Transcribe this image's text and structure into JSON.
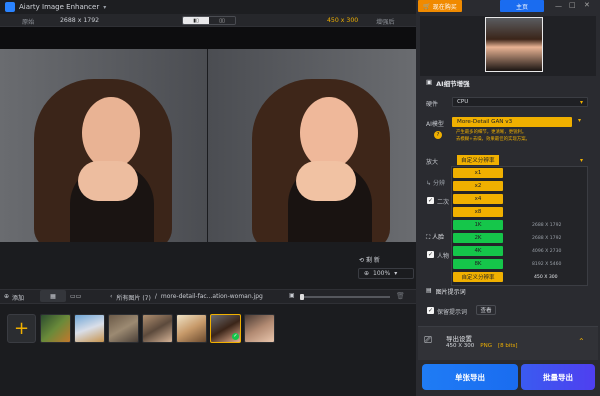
{
  "app": {
    "title": "Aiarty Image Enhancer"
  },
  "compare_bar": {
    "original_label": "原始",
    "original_size": "2688 x 1792",
    "output_size": "450 x 300",
    "output_label": "增强后"
  },
  "preview_controls": {
    "reset_label": "剩 新",
    "zoom": "100%"
  },
  "tabs": {
    "add_label": "添加",
    "breadcrumb_all": "所有图片 (7)",
    "breadcrumb_sep": "/",
    "file_name": "more-detail-fac...ation-woman.jpg"
  },
  "top_buttons": {
    "buy_label": "现在购买",
    "home_label": "主页"
  },
  "side": {
    "section_title": "AI细节增强",
    "hardware_label": "硬件",
    "hardware_value": "CPU",
    "model_label": "AI模型",
    "model_value": "More-Detail GAN  v3",
    "model_desc_line1": "产生最多的细节，更清晰，更锐利。",
    "model_desc_line2": "去模糊+去噪，效果最佳的实现方案。",
    "scale_label": "放大",
    "scale_value": "自定义分辨率",
    "scale_options": [
      {
        "label": "x1",
        "value": "",
        "color": "#f0b000"
      },
      {
        "label": "x2",
        "value": "",
        "color": "#f0b000"
      },
      {
        "label": "x4",
        "value": "",
        "color": "#f0b000"
      },
      {
        "label": "x8",
        "value": "",
        "color": "#f0b000"
      },
      {
        "label": "1K",
        "value": "2688 X 1792",
        "color": "#15c64a"
      },
      {
        "label": "2K",
        "value": "2688 X 1792",
        "color": "#15c64a"
      },
      {
        "label": "4K",
        "value": "4096 X 2730",
        "color": "#15c64a"
      },
      {
        "label": "8K",
        "value": "8192 X 5460",
        "color": "#15c64a"
      },
      {
        "label": "自定义分辨率",
        "value": "450 X 300",
        "color": "#f0b000"
      }
    ],
    "partial_1": "分辨",
    "partial_2": "二次",
    "partial_3": "人脸",
    "partial_4": "人物",
    "hint_label": "图片提示词",
    "keep_hint_label": "保留提示词",
    "view_label": "查看",
    "export_settings_label": "导出设置",
    "export_size": "450 X 300",
    "export_format": "PNG",
    "export_bits": "[8 bits]",
    "single_export": "单张导出",
    "batch_export": "批量导出"
  },
  "colors": {
    "accent": "#f0b000",
    "blue": "#1a6cf0",
    "green": "#15c64a",
    "orange_btn": "#f08a00"
  }
}
